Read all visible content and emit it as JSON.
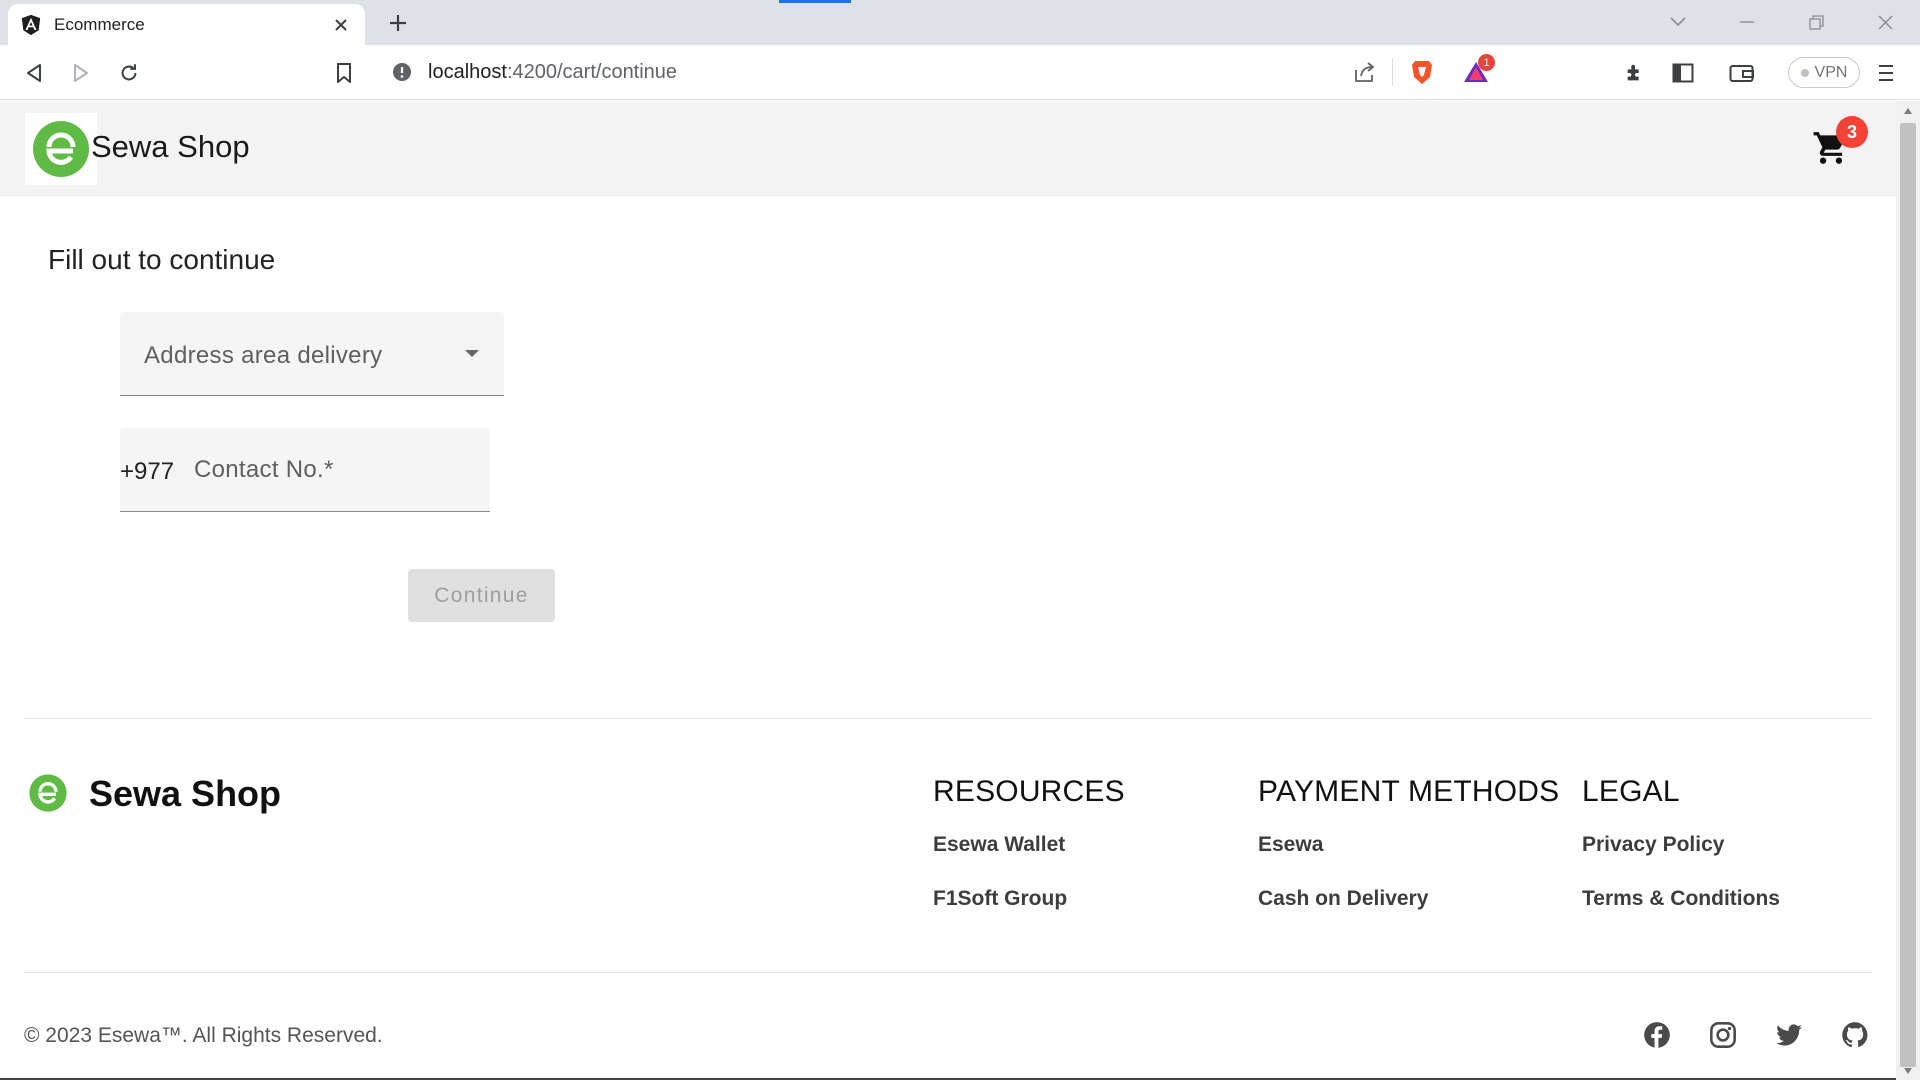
{
  "browser": {
    "tab_title": "Ecommerce",
    "url_host": "localhost",
    "url_path": ":4200/cart/continue",
    "vpn_label": "VPN",
    "brave_rewards_count": "1",
    "colors": {
      "tabbar": "#dee1e6",
      "accent": "#1a73e8"
    }
  },
  "header": {
    "brand": "Sewa Shop",
    "cart_count": "3",
    "brand_color": "#60bb46"
  },
  "form": {
    "title": "Fill out to continue",
    "address_select": {
      "label": "Address area delivery",
      "value": ""
    },
    "contact": {
      "prefix": "+977",
      "placeholder": "Contact No.*",
      "value": ""
    },
    "continue_label": "Continue"
  },
  "footer": {
    "brand": "Sewa Shop",
    "columns": [
      {
        "title": "RESOURCES",
        "links": [
          "Esewa Wallet",
          "F1Soft Group"
        ]
      },
      {
        "title": "PAYMENT METHODS",
        "links": [
          "Esewa",
          "Cash on Delivery"
        ]
      },
      {
        "title": "LEGAL",
        "links": [
          "Privacy Policy",
          "Terms & Conditions"
        ]
      }
    ],
    "copyright": "© 2023 Esewa™. All Rights Reserved.",
    "social_icons": [
      "facebook-icon",
      "instagram-icon",
      "twitter-icon",
      "github-icon"
    ]
  }
}
